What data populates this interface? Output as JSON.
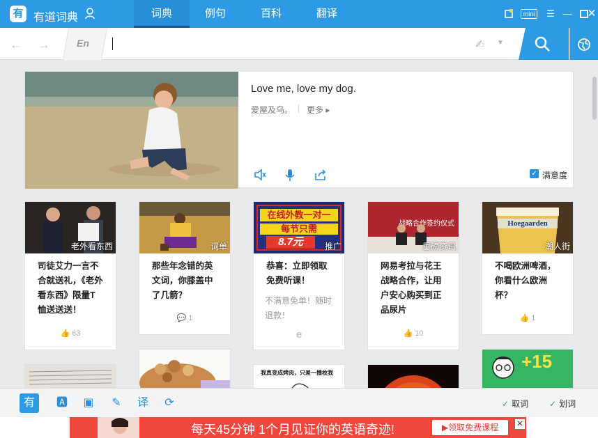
{
  "app": {
    "name": "有道词典"
  },
  "nav": {
    "tabs": [
      {
        "label": "词典",
        "active": true
      },
      {
        "label": "例句",
        "active": false
      },
      {
        "label": "百科",
        "active": false
      },
      {
        "label": "翻译",
        "active": false
      }
    ]
  },
  "window": {
    "mini_label": "mini"
  },
  "search": {
    "lang": "En",
    "value": ""
  },
  "daily": {
    "sentence": "Love me, love my dog.",
    "translation": "爱屋及乌。",
    "more_label": "更多",
    "satisfaction_label": "满意度"
  },
  "cards": [
    {
      "tag": "老外看东西",
      "title": "司徒艾力一言不合就送礼，《老外看东西》限量T恤送送送！",
      "likes": "63",
      "foot_icon": "thumb-up-icon"
    },
    {
      "tag": "词单",
      "title": "那些年念错的英文词，你膝盖中了几箭？",
      "likes": "1",
      "foot_icon": "comment-icon"
    },
    {
      "tag": "推广",
      "title": "恭喜：立即领取免费听课！",
      "subtitle": "不满意免单！随时退款！",
      "foot_icon": "e-logo-icon",
      "ad_line1": "在线外教一对一",
      "ad_line2": "每节只需",
      "ad_price": "8.7元"
    },
    {
      "tag": "重磅资讯",
      "title": "网易考拉与花王战略合作，让用户安心购买到正品尿片",
      "likes": "10",
      "foot_icon": "thumb-up-icon",
      "banner_text": "战略合作签约仪式"
    },
    {
      "tag": "潮人街",
      "title": "不喝欧洲啤酒，你看什么欧洲杯？",
      "likes": "1",
      "foot_icon": "thumb-up-icon",
      "banner_text": "Hoegaarden"
    }
  ],
  "bottom_cards": {
    "card3_text": "我真变成烤肉，只差一播枚我",
    "card5_text": "+15"
  },
  "toolbar": {
    "check1_label": "取词",
    "check2_label": "划词"
  },
  "ad": {
    "text": "每天45分钟 1个月见证你的英语奇迹!",
    "button": "▶领取免费课程"
  },
  "colors": {
    "accent": "#2d9ae6",
    "ad_red": "#f0463c"
  }
}
